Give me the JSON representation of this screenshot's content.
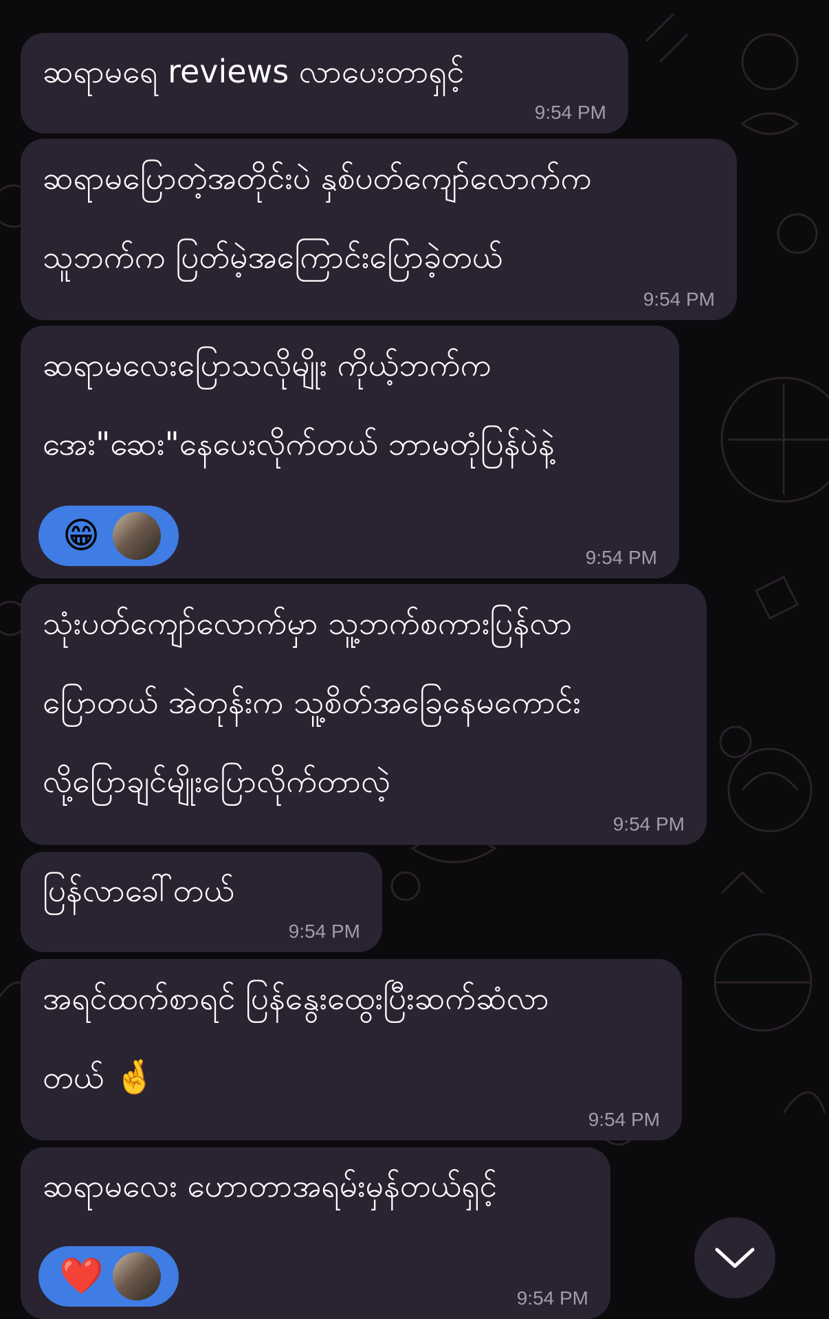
{
  "messages": [
    {
      "lines": [
        "ဆရာမရေ reviews လာပေးတာရှင့်"
      ],
      "time": "9:54 PM"
    },
    {
      "lines": [
        "ဆရာမပြောတဲ့အတိုင်းပဲ နှစ်ပတ်ကျော်လောက်က",
        "သူဘက်က ပြတ်မဲ့အကြောင်းပြောခဲ့တယ်"
      ],
      "time": "9:54 PM"
    },
    {
      "lines": [
        "ဆရာမလေးပြောသလိုမျိုး ကိုယ့်ဘက်က",
        "အေး\"ဆေး\"နေပေးလိုက်တယ် ဘာမတုံပြန်ပဲနဲ့"
      ],
      "time": "9:54 PM",
      "reaction": {
        "emoji": "😁",
        "icon": "grinning-face-emoji"
      }
    },
    {
      "lines": [
        "သုံးပတ်ကျော်လောက်မှာ သူ့ဘက်စကားပြန်လာ",
        "ပြောတယ် အဲတုန်းက သူ့စိတ်အခြေနေမကောင်း",
        "လို့ပြောချင်မျိုးပြောလိုက်တာလဲ့"
      ],
      "time": "9:54 PM"
    },
    {
      "lines": [
        "ပြန်လာခေါ်တယ်"
      ],
      "time": "9:54 PM"
    },
    {
      "lines": [
        "အရင်ထက်စာရင် ပြန်နွေးထွေးပြီးဆက်ဆံလာ",
        "တယ်"
      ],
      "inline_emoji": "🤞",
      "time": "9:54 PM"
    },
    {
      "lines": [
        "ဆရာမလေး ဟောတာအရမ်းမှန်တယ်ရှင့်"
      ],
      "time": "9:54 PM",
      "reaction": {
        "emoji": "❤️",
        "icon": "red-heart-emoji"
      }
    }
  ],
  "colors": {
    "background": "#0b0a0d",
    "bubble": "#2a2432",
    "text": "#ffffff",
    "timestamp": "#a39aab",
    "reaction_pill": "#3f7de4"
  },
  "scroll_button": {
    "icon": "chevron-down-icon"
  }
}
